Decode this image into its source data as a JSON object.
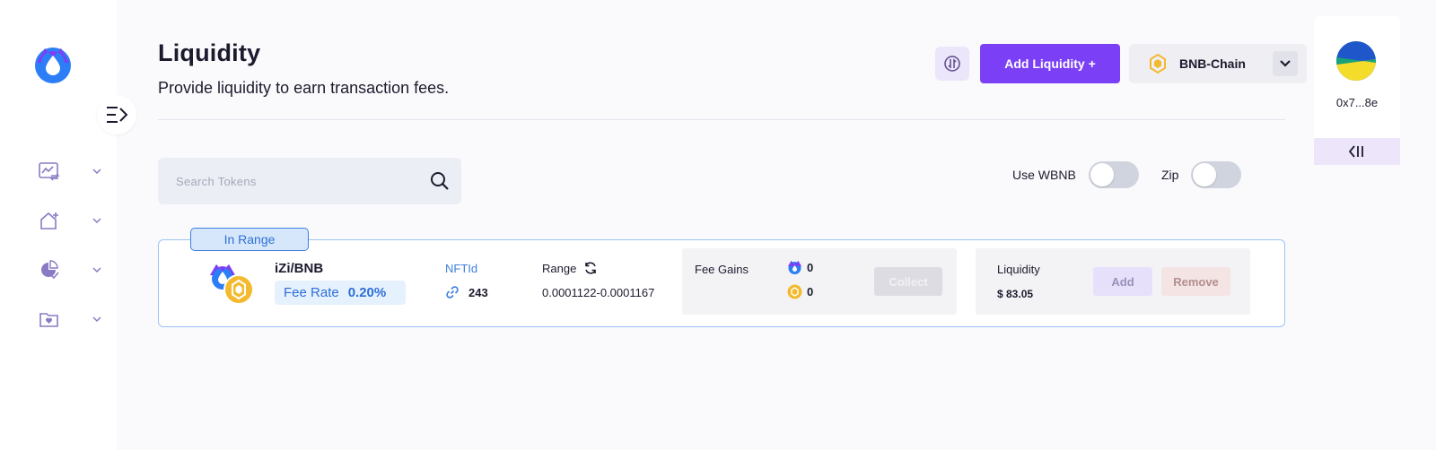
{
  "colors": {
    "accent": "#7b40f5",
    "range_blue": "#3d7fe0",
    "bnb_yellow": "#f3ba2f",
    "izi_blue": "#2b7ef6",
    "izi_purple": "#7b40f5"
  },
  "sidebar": {
    "items": [
      {
        "icon": "chart-exchange-icon"
      },
      {
        "icon": "home-plus-icon"
      },
      {
        "icon": "pie-check-icon"
      },
      {
        "icon": "folder-heart-icon"
      }
    ]
  },
  "header": {
    "title": "Liquidity",
    "subtitle": "Provide liquidity to earn transaction fees.",
    "add_liquidity_label": "Add Liquidity +",
    "chain": "BNB-Chain"
  },
  "search": {
    "placeholder": "Search Tokens"
  },
  "toggles": {
    "wbnb_label": "Use WBNB",
    "wbnb_on": false,
    "zip_label": "Zip",
    "zip_on": false
  },
  "position": {
    "status": "In Range",
    "pair": "iZi/BNB",
    "fee_rate_label": "Fee Rate",
    "fee_rate": "0.20%",
    "nft_label": "NFTId",
    "nft_id": "243",
    "range_label": "Range",
    "range": "0.0001122-0.0001167",
    "fee_gains_label": "Fee Gains",
    "gain_izi": "0",
    "gain_bnb": "0",
    "collect_label": "Collect",
    "liquidity_label": "Liquidity",
    "liquidity_value": "$ 83.05",
    "add_label": "Add",
    "remove_label": "Remove"
  },
  "wallet": {
    "address": "0x7...8e"
  }
}
